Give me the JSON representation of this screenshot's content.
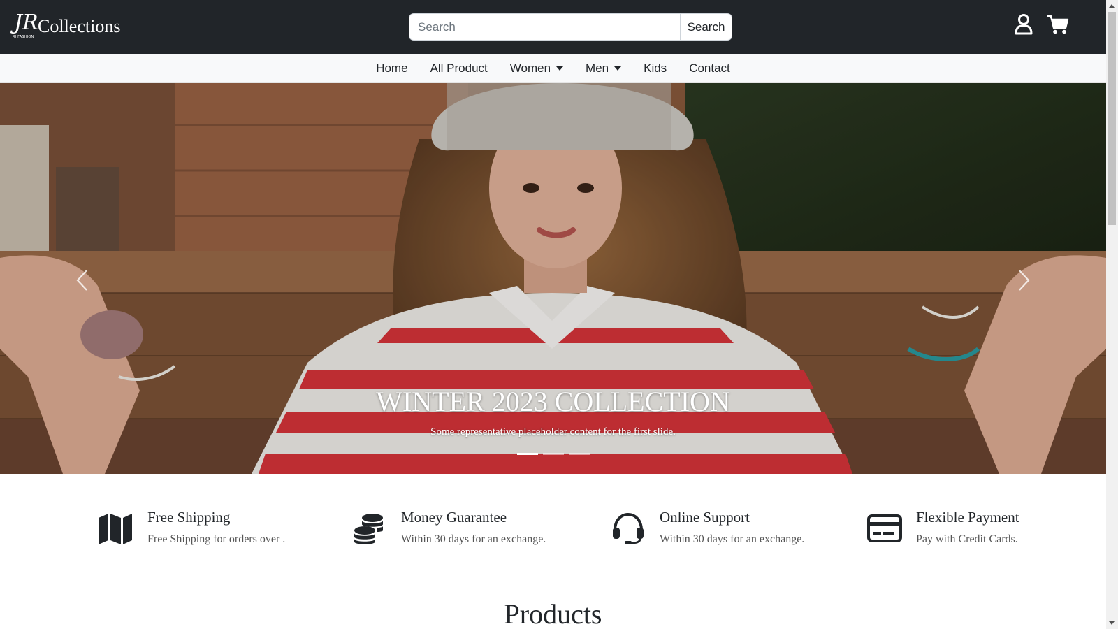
{
  "header": {
    "brand_name": "Collections",
    "logo_monogram": "JR",
    "logo_subtext": "RJ FASHION",
    "search_placeholder": "Search",
    "search_button": "Search",
    "icons": [
      "user-icon",
      "cart-icon"
    ]
  },
  "nav": {
    "items": [
      {
        "label": "Home",
        "dropdown": false
      },
      {
        "label": "All Product",
        "dropdown": false
      },
      {
        "label": "Women",
        "dropdown": true
      },
      {
        "label": "Men",
        "dropdown": true
      },
      {
        "label": "Kids",
        "dropdown": false
      },
      {
        "label": "Contact",
        "dropdown": false
      }
    ]
  },
  "hero": {
    "title": "WINTER 2023 COLLECTION",
    "subtitle": "Some representative placeholder content for the first slide.",
    "slide_count": 3,
    "active_slide": 1,
    "icons": [
      "chevron-left-icon",
      "chevron-right-icon"
    ]
  },
  "features": [
    {
      "icon": "map-icon",
      "title": "Free Shipping",
      "desc": "Free Shipping for orders over ."
    },
    {
      "icon": "coins-icon",
      "title": "Money Guarantee",
      "desc": "Within 30 days for an exchange."
    },
    {
      "icon": "headset-icon",
      "title": "Online Support",
      "desc": "Within 30 days for an exchange."
    },
    {
      "icon": "credit-card-icon",
      "title": "Flexible Payment",
      "desc": "Pay with Credit Cards."
    }
  ],
  "products": {
    "title": "Products"
  },
  "colors": {
    "header_bg": "#212529",
    "nav_bg": "#f8f9fa",
    "accent_red": "#d8343a"
  }
}
